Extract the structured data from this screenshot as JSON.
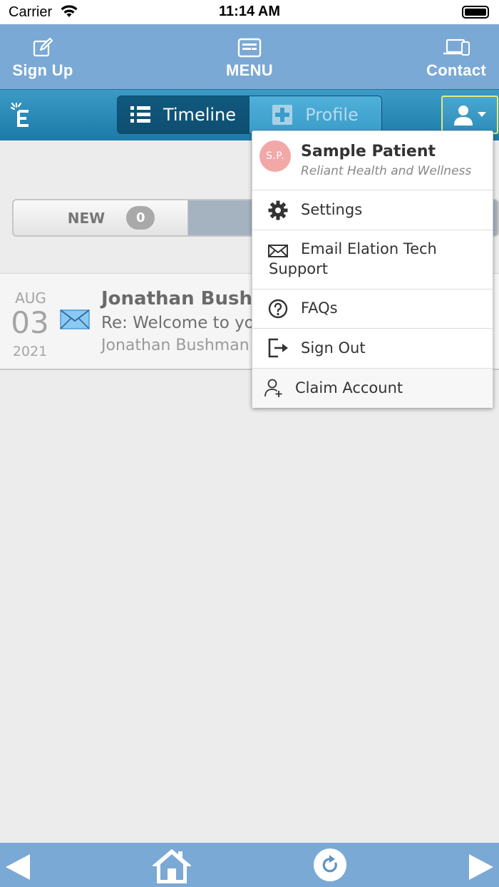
{
  "status_bar": {
    "carrier": "Carrier",
    "time": "11:14 AM"
  },
  "top_nav": {
    "sign_up": "Sign Up",
    "menu": "MENU",
    "contact": "Contact"
  },
  "toolbar": {
    "timeline_label": "Timeline",
    "profile_label": "Profile"
  },
  "filter": {
    "new_label": "NEW",
    "new_count": "0"
  },
  "message": {
    "month": "AUG",
    "day": "03",
    "year": "2021",
    "from": "Jonathan Bushn",
    "subject": "Re: Welcome to you",
    "sender": "Jonathan Bushman"
  },
  "user_menu": {
    "initials": "S.P.",
    "name": "Sample Patient",
    "organization": "Reliant Health and Wellness",
    "items": {
      "settings": "Settings",
      "email_line1": "Email Elation Tech",
      "email_line2": "Support",
      "faqs": "FAQs",
      "sign_out": "Sign Out",
      "claim_account": "Claim Account"
    }
  },
  "colors": {
    "nav_blue": "#7aa9d5",
    "toolbar_blue": "#1d7aa8",
    "avatar_pink": "#f3a8a8"
  }
}
